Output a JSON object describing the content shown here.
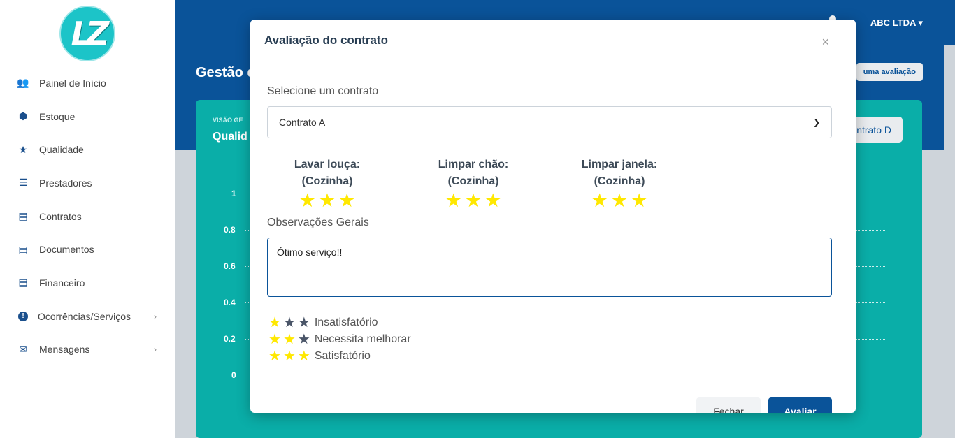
{
  "logo": {
    "text": "LZ"
  },
  "sidebar": {
    "items": [
      {
        "label": "Painel de Início",
        "icon": "users-icon",
        "glyph": "👥"
      },
      {
        "label": "Estoque",
        "icon": "box-icon",
        "glyph": "⬢"
      },
      {
        "label": "Qualidade",
        "icon": "star-icon",
        "glyph": "★"
      },
      {
        "label": "Prestadores",
        "icon": "list-check-icon",
        "glyph": "☰"
      },
      {
        "label": "Contratos",
        "icon": "file-contract-icon",
        "glyph": "▤"
      },
      {
        "label": "Documentos",
        "icon": "file-text-icon",
        "glyph": "▤"
      },
      {
        "label": "Financeiro",
        "icon": "file-invoice-dollar-icon",
        "glyph": "▤"
      },
      {
        "label": "Ocorrências/Serviços",
        "icon": "alert-circle-icon",
        "glyph": "!",
        "arrow": "›"
      },
      {
        "label": "Mensagens",
        "icon": "envelope-icon",
        "glyph": "✉",
        "arrow": "›"
      }
    ]
  },
  "header": {
    "user": "ABC LTDA ▾"
  },
  "page": {
    "title": "Gestão d",
    "new_button": "uma avaliação"
  },
  "card": {
    "subtitle": "VISÃO GE",
    "title": "Qualid",
    "button": "ntrato D"
  },
  "chart": {
    "y_ticks": [
      "1",
      "0.8",
      "0.6",
      "0.4",
      "0.2",
      "0"
    ]
  },
  "modal": {
    "title": "Avaliação do contrato",
    "close": "×",
    "select_label": "Selecione um contrato",
    "select_value": "Contrato A",
    "tasks": [
      {
        "line1": "Lavar louça:",
        "line2": "(Cozinha)",
        "stars": 3
      },
      {
        "line1": "Limpar chão:",
        "line2": "(Cozinha)",
        "stars": 3
      },
      {
        "line1": "Limpar janela:",
        "line2": "(Cozinha)",
        "stars": 3
      }
    ],
    "notes_label": "Observações Gerais",
    "notes_value": "Ótimo serviço!!",
    "legend": [
      {
        "text": "Insatisfatório",
        "filled": 1
      },
      {
        "text": "Necessita melhorar",
        "filled": 2
      },
      {
        "text": "Satisfatório",
        "filled": 3
      }
    ],
    "close_button": "Fechar",
    "submit_button": "Avaliar"
  },
  "colors": {
    "primary": "#0a5399",
    "teal": "#0aaea8",
    "star": "#ffe800"
  }
}
